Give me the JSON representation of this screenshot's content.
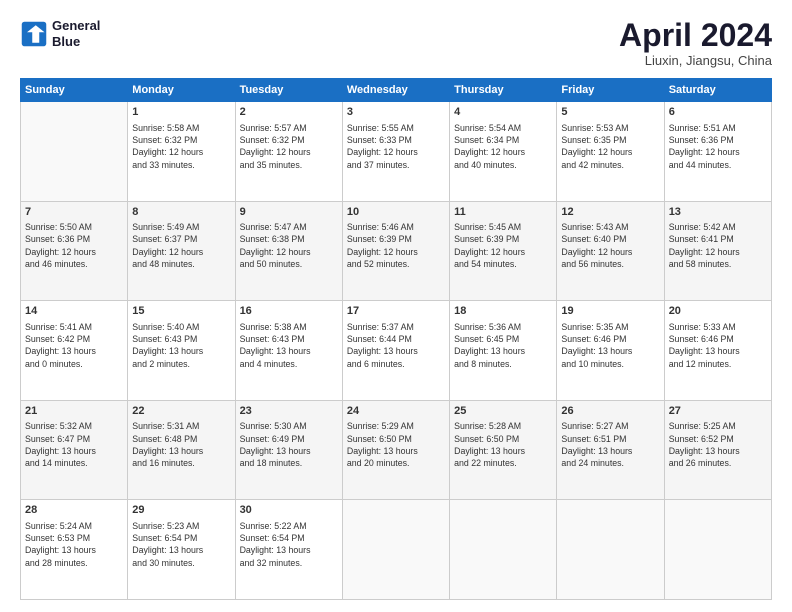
{
  "logo": {
    "line1": "General",
    "line2": "Blue"
  },
  "title": "April 2024",
  "subtitle": "Liuxin, Jiangsu, China",
  "weekdays": [
    "Sunday",
    "Monday",
    "Tuesday",
    "Wednesday",
    "Thursday",
    "Friday",
    "Saturday"
  ],
  "weeks": [
    [
      {
        "day": "",
        "info": ""
      },
      {
        "day": "1",
        "info": "Sunrise: 5:58 AM\nSunset: 6:32 PM\nDaylight: 12 hours\nand 33 minutes."
      },
      {
        "day": "2",
        "info": "Sunrise: 5:57 AM\nSunset: 6:32 PM\nDaylight: 12 hours\nand 35 minutes."
      },
      {
        "day": "3",
        "info": "Sunrise: 5:55 AM\nSunset: 6:33 PM\nDaylight: 12 hours\nand 37 minutes."
      },
      {
        "day": "4",
        "info": "Sunrise: 5:54 AM\nSunset: 6:34 PM\nDaylight: 12 hours\nand 40 minutes."
      },
      {
        "day": "5",
        "info": "Sunrise: 5:53 AM\nSunset: 6:35 PM\nDaylight: 12 hours\nand 42 minutes."
      },
      {
        "day": "6",
        "info": "Sunrise: 5:51 AM\nSunset: 6:36 PM\nDaylight: 12 hours\nand 44 minutes."
      }
    ],
    [
      {
        "day": "7",
        "info": "Sunrise: 5:50 AM\nSunset: 6:36 PM\nDaylight: 12 hours\nand 46 minutes."
      },
      {
        "day": "8",
        "info": "Sunrise: 5:49 AM\nSunset: 6:37 PM\nDaylight: 12 hours\nand 48 minutes."
      },
      {
        "day": "9",
        "info": "Sunrise: 5:47 AM\nSunset: 6:38 PM\nDaylight: 12 hours\nand 50 minutes."
      },
      {
        "day": "10",
        "info": "Sunrise: 5:46 AM\nSunset: 6:39 PM\nDaylight: 12 hours\nand 52 minutes."
      },
      {
        "day": "11",
        "info": "Sunrise: 5:45 AM\nSunset: 6:39 PM\nDaylight: 12 hours\nand 54 minutes."
      },
      {
        "day": "12",
        "info": "Sunrise: 5:43 AM\nSunset: 6:40 PM\nDaylight: 12 hours\nand 56 minutes."
      },
      {
        "day": "13",
        "info": "Sunrise: 5:42 AM\nSunset: 6:41 PM\nDaylight: 12 hours\nand 58 minutes."
      }
    ],
    [
      {
        "day": "14",
        "info": "Sunrise: 5:41 AM\nSunset: 6:42 PM\nDaylight: 13 hours\nand 0 minutes."
      },
      {
        "day": "15",
        "info": "Sunrise: 5:40 AM\nSunset: 6:43 PM\nDaylight: 13 hours\nand 2 minutes."
      },
      {
        "day": "16",
        "info": "Sunrise: 5:38 AM\nSunset: 6:43 PM\nDaylight: 13 hours\nand 4 minutes."
      },
      {
        "day": "17",
        "info": "Sunrise: 5:37 AM\nSunset: 6:44 PM\nDaylight: 13 hours\nand 6 minutes."
      },
      {
        "day": "18",
        "info": "Sunrise: 5:36 AM\nSunset: 6:45 PM\nDaylight: 13 hours\nand 8 minutes."
      },
      {
        "day": "19",
        "info": "Sunrise: 5:35 AM\nSunset: 6:46 PM\nDaylight: 13 hours\nand 10 minutes."
      },
      {
        "day": "20",
        "info": "Sunrise: 5:33 AM\nSunset: 6:46 PM\nDaylight: 13 hours\nand 12 minutes."
      }
    ],
    [
      {
        "day": "21",
        "info": "Sunrise: 5:32 AM\nSunset: 6:47 PM\nDaylight: 13 hours\nand 14 minutes."
      },
      {
        "day": "22",
        "info": "Sunrise: 5:31 AM\nSunset: 6:48 PM\nDaylight: 13 hours\nand 16 minutes."
      },
      {
        "day": "23",
        "info": "Sunrise: 5:30 AM\nSunset: 6:49 PM\nDaylight: 13 hours\nand 18 minutes."
      },
      {
        "day": "24",
        "info": "Sunrise: 5:29 AM\nSunset: 6:50 PM\nDaylight: 13 hours\nand 20 minutes."
      },
      {
        "day": "25",
        "info": "Sunrise: 5:28 AM\nSunset: 6:50 PM\nDaylight: 13 hours\nand 22 minutes."
      },
      {
        "day": "26",
        "info": "Sunrise: 5:27 AM\nSunset: 6:51 PM\nDaylight: 13 hours\nand 24 minutes."
      },
      {
        "day": "27",
        "info": "Sunrise: 5:25 AM\nSunset: 6:52 PM\nDaylight: 13 hours\nand 26 minutes."
      }
    ],
    [
      {
        "day": "28",
        "info": "Sunrise: 5:24 AM\nSunset: 6:53 PM\nDaylight: 13 hours\nand 28 minutes."
      },
      {
        "day": "29",
        "info": "Sunrise: 5:23 AM\nSunset: 6:54 PM\nDaylight: 13 hours\nand 30 minutes."
      },
      {
        "day": "30",
        "info": "Sunrise: 5:22 AM\nSunset: 6:54 PM\nDaylight: 13 hours\nand 32 minutes."
      },
      {
        "day": "",
        "info": ""
      },
      {
        "day": "",
        "info": ""
      },
      {
        "day": "",
        "info": ""
      },
      {
        "day": "",
        "info": ""
      }
    ]
  ]
}
